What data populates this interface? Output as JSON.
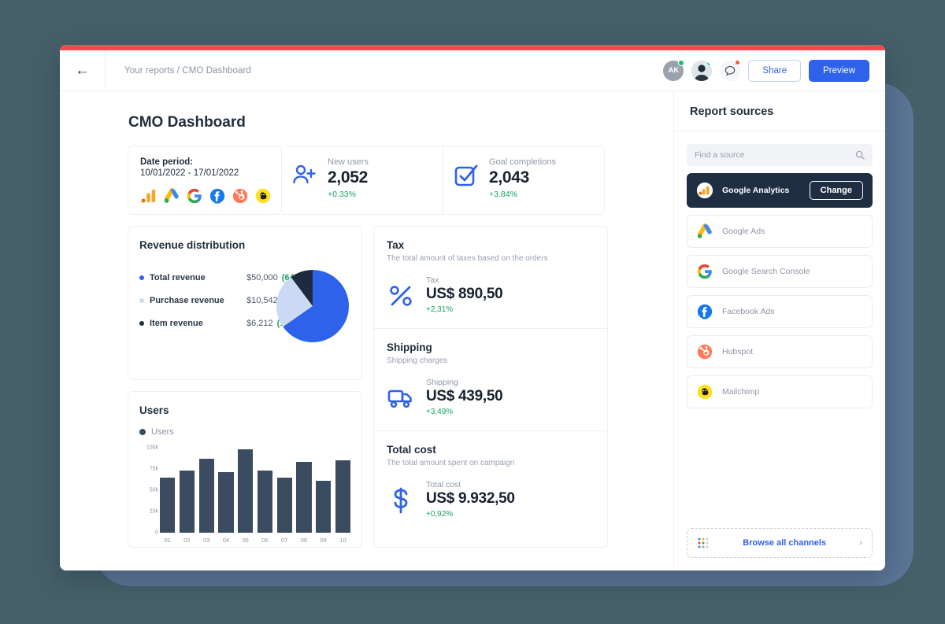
{
  "window": {
    "accent_red": "#f9474f"
  },
  "topbar": {
    "back_icon": "arrow-left-icon",
    "breadcrumb": "Your reports / CMO Dashboard",
    "avatar_initials": "AK",
    "chat_icon": "chat-bubble-icon",
    "share_label": "Share",
    "preview_label": "Preview"
  },
  "page": {
    "title": "CMO Dashboard"
  },
  "date_period": {
    "label": "Date period:",
    "value": "10/01/2022 - 17/01/2022",
    "source_icons": [
      "google-analytics-icon",
      "google-ads-icon",
      "google-icon",
      "facebook-ads-icon",
      "hubspot-icon",
      "mailchimp-icon"
    ]
  },
  "kpis": [
    {
      "icon": "user-add-icon",
      "label": "New users",
      "value": "2,052",
      "delta": "+0.33%"
    },
    {
      "icon": "checkbox-check-icon",
      "label": "Goal completions",
      "value": "2,043",
      "delta": "+3.84%"
    }
  ],
  "revenue": {
    "title": "Revenue distribution",
    "rows": [
      {
        "name": "Total revenue",
        "amount": "$50,000",
        "pct": "(64%)",
        "color": "#2f62ea"
      },
      {
        "name": "Purchase revenue",
        "amount": "$10,542",
        "pct": "(24%)",
        "color": "#ccd9f5"
      },
      {
        "name": "Item revenue",
        "amount": "$6,212",
        "pct": "(10%)",
        "color": "#1e2a3d"
      }
    ]
  },
  "users_chart": {
    "title": "Users",
    "legend": "Users"
  },
  "metrics": [
    {
      "title": "Tax",
      "subtitle": "The total amount of taxes based on the orders",
      "icon": "percent-icon",
      "label": "Tax",
      "value": "US$ 890,50",
      "delta": "+2,31%"
    },
    {
      "title": "Shipping",
      "subtitle": "Shipping charges",
      "icon": "truck-icon",
      "label": "Shipping",
      "value": "US$ 439,50",
      "delta": "+3,49%"
    },
    {
      "title": "Total cost",
      "subtitle": "The total amount spent on campaign",
      "icon": "dollar-icon",
      "label": "Total cost",
      "value": "US$ 9.932,50",
      "delta": "+0,92%"
    }
  ],
  "report_sources": {
    "heading": "Report sources",
    "search_placeholder": "Find a source",
    "search_icon": "search-icon",
    "change_label": "Change",
    "items": [
      {
        "name": "Google Analytics",
        "icon": "google-analytics-icon",
        "active": true
      },
      {
        "name": "Google Ads",
        "icon": "google-ads-icon",
        "active": false
      },
      {
        "name": "Google Search Console",
        "icon": "google-icon",
        "active": false
      },
      {
        "name": "Facebook Ads",
        "icon": "facebook-ads-icon",
        "active": false
      },
      {
        "name": "Hubspot",
        "icon": "hubspot-icon",
        "active": false
      },
      {
        "name": "Mailchimp",
        "icon": "mailchimp-icon",
        "active": false
      }
    ],
    "browse_label": "Browse all channels",
    "browse_icon": "grid-dots-icon",
    "chevron_icon": "chevron-right-icon"
  },
  "chart_data": [
    {
      "type": "pie",
      "title": "Revenue distribution",
      "labels": [
        "Total revenue",
        "Purchase revenue",
        "Item revenue"
      ],
      "values": [
        64,
        24,
        10
      ],
      "amounts": [
        "$50,000",
        "$10,542",
        "$6,212"
      ],
      "colors": [
        "#2f62ea",
        "#ccd9f5",
        "#1e2a3d"
      ],
      "legend": "left"
    },
    {
      "type": "bar",
      "title": "Users",
      "categories": [
        "01",
        "02",
        "03",
        "04",
        "05",
        "06",
        "07",
        "08",
        "09",
        "10"
      ],
      "series": [
        {
          "name": "Users",
          "values": [
            65000,
            73000,
            87000,
            71000,
            98000,
            73000,
            65000,
            83000,
            61000,
            85000
          ]
        }
      ],
      "ylim": [
        0,
        100000
      ],
      "yticks": [
        "0",
        "25k",
        "50k",
        "75k",
        "100k"
      ],
      "xlabel": "",
      "ylabel": "",
      "grid": false,
      "legend": "top-left",
      "bar_color": "#3c4c60"
    }
  ]
}
